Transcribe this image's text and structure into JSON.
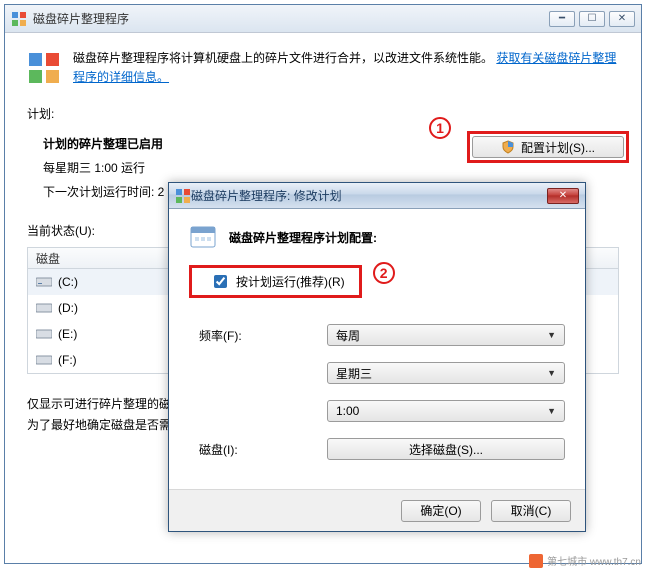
{
  "main": {
    "title": "磁盘碎片整理程序",
    "info_text": "磁盘碎片整理程序将计算机硬盘上的碎片文件进行合并，以改进文件系统性能。",
    "info_link": "获取有关磁盘碎片整理程序的详细信息。",
    "plan_label": "计划:",
    "plan_status": "计划的碎片整理已启用",
    "schedule_line1": "每星期三  1:00 运行",
    "schedule_line2": "下一次计划运行时间: 2",
    "config_button": "配置计划(S)...",
    "status_label": "当前状态(U):",
    "disk_header": "磁盘",
    "drives": [
      "(C:)",
      "(D:)",
      "(E:)",
      "(F:)"
    ],
    "hint1": "仅显示可进行碎片整理的磁",
    "hint2": "为了最好地确定磁盘是否需"
  },
  "callouts": {
    "one": "1",
    "two": "2"
  },
  "dialog": {
    "title": "磁盘碎片整理程序: 修改计划",
    "header": "磁盘碎片整理程序计划配置:",
    "checkbox_label": "按计划运行(推荐)(R)",
    "freq_label": "频率(F):",
    "freq_value": "每周",
    "day_value": "星期三",
    "time_value": "1:00",
    "disk_label": "磁盘(I):",
    "select_disk": "选择磁盘(S)...",
    "ok": "确定(O)",
    "cancel": "取消(C)"
  },
  "watermark": "第七城市 www.th7.cn"
}
